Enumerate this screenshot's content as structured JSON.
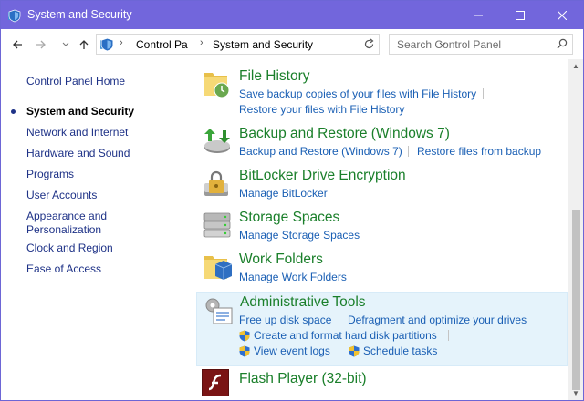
{
  "window": {
    "title": "System and Security",
    "minimize_icon": "minimize-icon",
    "maximize_icon": "maximize-icon",
    "close_icon": "close-icon"
  },
  "address": {
    "crumbs": [
      "Control Pa",
      "System and Security"
    ],
    "search_placeholder": "Search Control Panel"
  },
  "leftnav": {
    "items": [
      {
        "label": "Control Panel Home"
      },
      {
        "label": "System and Security",
        "active": true
      },
      {
        "label": "Network and Internet"
      },
      {
        "label": "Hardware and Sound"
      },
      {
        "label": "Programs"
      },
      {
        "label": "User Accounts"
      },
      {
        "label": "Appearance and\nPersonalization",
        "line1": "Appearance and",
        "line2": "Personalization"
      },
      {
        "label": "Clock and Region"
      },
      {
        "label": "Ease of Access"
      }
    ]
  },
  "main": {
    "file_history": {
      "title": "File History",
      "link1": "Save backup copies of your files with File History",
      "link2": "Restore your files with File History"
    },
    "backup": {
      "title": "Backup and Restore (Windows 7)",
      "link1": "Backup and Restore (Windows 7)",
      "link2": "Restore files from backup"
    },
    "bitlocker": {
      "title": "BitLocker Drive Encryption",
      "link1": "Manage BitLocker"
    },
    "storage": {
      "title": "Storage Spaces",
      "link1": "Manage Storage Spaces"
    },
    "work_folders": {
      "title": "Work Folders",
      "link1": "Manage Work Folders"
    },
    "admin_tools": {
      "title": "Administrative Tools",
      "link1": "Free up disk space",
      "link2": "Defragment and optimize your drives",
      "link3": "Create and format hard disk partitions",
      "link4": "View event logs",
      "link5": "Schedule tasks"
    },
    "flash": {
      "title": "Flash Player (32-bit)"
    }
  },
  "colors": {
    "titlebar": "#7266dc",
    "group_title": "#1a7f2a",
    "link": "#1a5fb4",
    "nav_link": "#1e3287",
    "highlight": "#e5f3fb"
  }
}
